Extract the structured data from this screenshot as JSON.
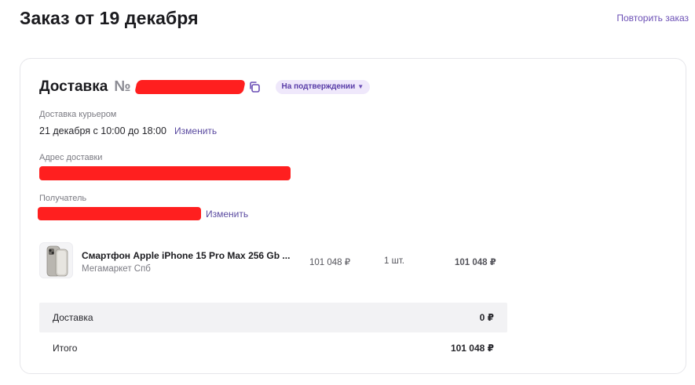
{
  "page": {
    "title": "Заказ от 19 декабря",
    "repeat_order": "Повторить заказ"
  },
  "delivery": {
    "title": "Доставка",
    "number_sign": "№",
    "status": "На подтверждении",
    "courier_label": "Доставка курьером",
    "courier_time": "21 декабря с 10:00 до 18:00",
    "change_label": "Изменить",
    "address_label": "Адрес доставки",
    "recipient_label": "Получатель",
    "recipient_change": "Изменить"
  },
  "product": {
    "name": "Смартфон Apple iPhone 15 Pro Max 256 Gb ...",
    "seller": "Мегамаркет Спб",
    "price": "101 048 ₽",
    "quantity": "1 шт.",
    "total": "101 048 ₽"
  },
  "summary": {
    "delivery_label": "Доставка",
    "delivery_value": "0 ₽",
    "total_label": "Итого",
    "total_value": "101 048 ₽"
  },
  "colors": {
    "accent": "#6b4fb5",
    "badge_bg": "#efe8fb",
    "redaction": "#ff1f1f"
  },
  "icons": {
    "copy": "copy-icon",
    "status_chevron": "chevron-down-icon",
    "product_image": "iphone-product-image"
  }
}
